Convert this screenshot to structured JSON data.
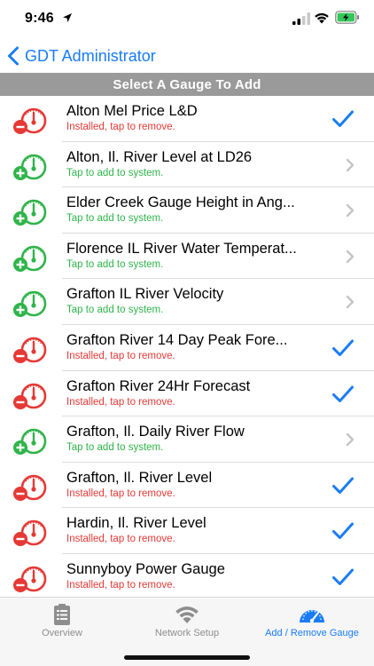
{
  "status_bar": {
    "time": "9:46"
  },
  "nav": {
    "back_label": "GDT Administrator"
  },
  "section_header": "Select A Gauge To Add",
  "colors": {
    "accent": "#1a7cf5",
    "installed": "#e53935",
    "available": "#2fb44a",
    "header_bg": "#9a9a9a"
  },
  "gauges": [
    {
      "title": "Alton Mel Price L&D",
      "status": "Installed, tap to remove.",
      "installed": true
    },
    {
      "title": "Alton, Il. River Level at LD26",
      "status": "Tap to add to system.",
      "installed": false
    },
    {
      "title": "Elder Creek Gauge Height in Ang...",
      "status": "Tap to add to system.",
      "installed": false
    },
    {
      "title": "Florence IL River Water Temperat...",
      "status": "Tap to add to system.",
      "installed": false
    },
    {
      "title": "Grafton IL River Velocity",
      "status": "Tap to add to system.",
      "installed": false
    },
    {
      "title": "Grafton River 14 Day Peak Fore...",
      "status": "Installed, tap to remove.",
      "installed": true
    },
    {
      "title": "Grafton River 24Hr Forecast",
      "status": "Installed, tap to remove.",
      "installed": true
    },
    {
      "title": "Grafton, Il. Daily River Flow",
      "status": "Tap to add to system.",
      "installed": false
    },
    {
      "title": "Grafton, Il. River Level",
      "status": "Installed, tap to remove.",
      "installed": true
    },
    {
      "title": "Hardin, Il. River Level",
      "status": "Installed, tap to remove.",
      "installed": true
    },
    {
      "title": "Sunnyboy Power Gauge",
      "status": "Installed, tap to remove.",
      "installed": true
    }
  ],
  "tabs": [
    {
      "label": "Overview",
      "icon": "clipboard-icon",
      "active": false
    },
    {
      "label": "Network Setup",
      "icon": "wifi-icon",
      "active": false
    },
    {
      "label": "Add / Remove Gauge",
      "icon": "gauge-icon",
      "active": true
    }
  ]
}
